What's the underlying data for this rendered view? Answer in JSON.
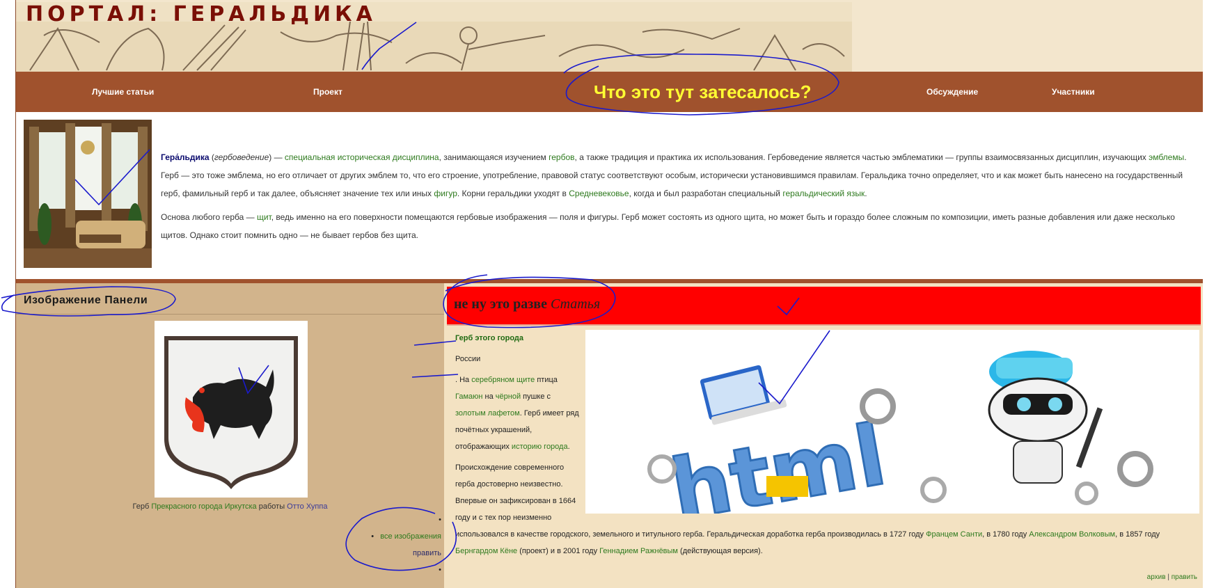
{
  "header": {
    "title": "ПОРТАЛ: ГЕРАЛЬДИКА"
  },
  "nav": {
    "items": [
      "Лучшие статьи",
      "Проект",
      "Обсуждение",
      "Участники"
    ],
    "highlight": "Что это тут затесалось?"
  },
  "intro": {
    "term": "Гера́льдика",
    "alt": "гербоведение",
    "p1": [
      {
        "t": " ("
      },
      {
        "t": "гербоведение",
        "i": true
      },
      {
        "t": ") — "
      },
      {
        "t": "специальная историческая дисциплина",
        "link": true
      },
      {
        "t": ", занимающаяся изучением "
      },
      {
        "t": "гербов",
        "link": true
      },
      {
        "t": ", а также традиция и практика их использования. Гербоведение является частью эмблематики — группы взаимосвязанных дисциплин, изучающих "
      },
      {
        "t": "эмблемы",
        "link": true
      },
      {
        "t": ". Герб — это тоже эмблема, но его отличает от других эмблем то, что его строение, употребление, правовой статус соответствуют особым, исторически установившимся правилам. Геральдика точно определяет, что и как может быть нанесено на государственный герб, фамильный герб и так далее, объясняет значение тех или иных "
      },
      {
        "t": "фигур",
        "link": true
      },
      {
        "t": ". Корни геральдики уходят в "
      },
      {
        "t": "Средневековье",
        "link": true
      },
      {
        "t": ", когда и был разработан специальный "
      },
      {
        "t": "геральдический язык",
        "link": true
      },
      {
        "t": "."
      }
    ],
    "p2": [
      {
        "t": "Основа любого герба — "
      },
      {
        "t": "щит",
        "link": true
      },
      {
        "t": ", ведь именно на его поверхности помещаются гербовые изображения — поля и фигуры. Герб может состоять из одного щита, но может быть и гораздо более сложным по композиции, иметь разные добавления или даже несколько щитов. Однако стоит помнить одно — не бывает гербов без щита."
      }
    ]
  },
  "panel": {
    "title": "Изображение Панели",
    "caption_prefix": "Герб ",
    "caption_link": "Прекрасного города Иркутска",
    "caption_mid": " работы ",
    "caption_author": "Отто Хуппа",
    "list": [
      "",
      "все изображения",
      "править",
      ""
    ]
  },
  "article": {
    "head_plain": "не ну это разве ",
    "head_italic": "Статья",
    "heading": "Герб этого города",
    "line_russia": "России",
    "p1": [
      {
        "t": ". На "
      },
      {
        "t": "серебряном щите",
        "link": true
      },
      {
        "t": " птица "
      },
      {
        "t": "Гамаюн",
        "link": true
      },
      {
        "t": " на "
      },
      {
        "t": "чёрной",
        "link": true
      },
      {
        "t": " пушке с "
      },
      {
        "t": "золотым лафетом",
        "link": true
      },
      {
        "t": ". Герб имеет ряд почётных украшений, отображающих "
      },
      {
        "t": "историю города",
        "link": true
      },
      {
        "t": "."
      }
    ],
    "p2_narrow": "Происхождение современного герба достоверно неизвестно. Впервые он зафиксирован в 1664 году и с тех пор неизменно",
    "p2_wide": [
      {
        "t": "использовался в качестве городского, земельного и титульного герба. Геральдическая доработка герба производилась в 1727 году "
      },
      {
        "t": "Францем Санти",
        "link": true
      },
      {
        "t": ", в 1780 году "
      },
      {
        "t": "Александром Волковым",
        "link": true
      },
      {
        "t": ", в 1857 году "
      },
      {
        "t": "Бернгардом Кёне",
        "link": true
      },
      {
        "t": " (проект) и в 2001 году "
      },
      {
        "t": "Геннадием Ражнёвым",
        "link": true
      },
      {
        "t": " (действующая версия)."
      }
    ],
    "image_word": "html",
    "footer": [
      "архив",
      "править"
    ]
  }
}
